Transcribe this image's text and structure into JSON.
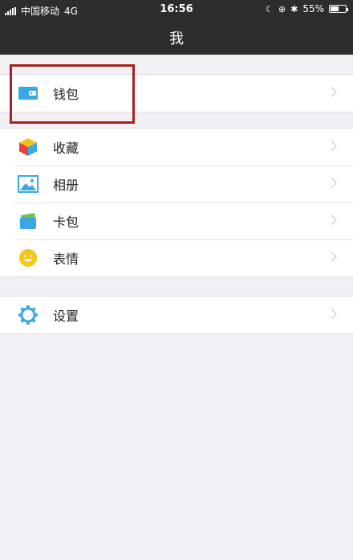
{
  "status_bar": {
    "carrier": "中国移动",
    "network": "4G",
    "time": "16:56",
    "battery": "55%",
    "battery_level": 0.55
  },
  "nav": {
    "title": "我"
  },
  "groups": [
    {
      "items": [
        {
          "label": "钱包",
          "icon": "wallet-icon"
        }
      ]
    },
    {
      "items": [
        {
          "label": "收藏",
          "icon": "favorites-cube-icon"
        },
        {
          "label": "相册",
          "icon": "album-picture-icon"
        },
        {
          "label": "卡包",
          "icon": "card-package-icon"
        },
        {
          "label": "表情",
          "icon": "emoji-smiley-icon"
        }
      ]
    },
    {
      "items": [
        {
          "label": "设置",
          "icon": "settings-gear-icon"
        }
      ]
    }
  ],
  "colors": {
    "navbar": "#2d2d30",
    "background": "#efeff4",
    "highlight_box": "#a5221f"
  }
}
